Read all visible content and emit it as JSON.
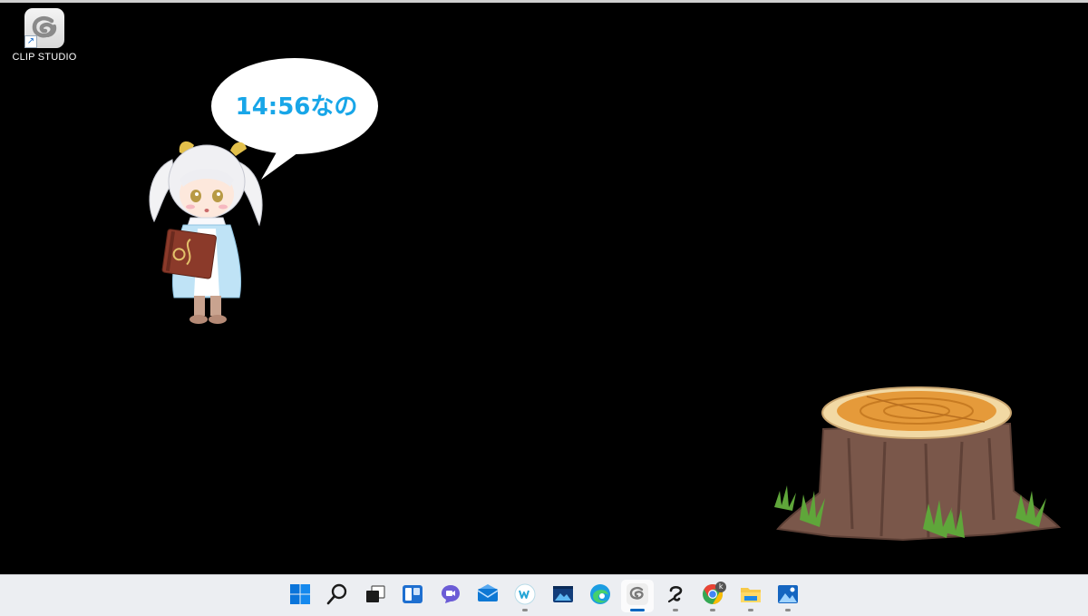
{
  "desktop": {
    "shortcut_label": "CLIP STUDIO",
    "speech_bubble_text": "14:56なの"
  },
  "taskbar": {
    "items": [
      {
        "icon": "windows-start-icon",
        "running": false
      },
      {
        "icon": "search-icon",
        "running": false
      },
      {
        "icon": "task-view-icon",
        "running": false
      },
      {
        "icon": "widgets-icon",
        "running": false
      },
      {
        "icon": "teams-chat-icon",
        "running": false
      },
      {
        "icon": "mail-icon",
        "running": false
      },
      {
        "icon": "w-app-icon",
        "running": true
      },
      {
        "icon": "video-editor-icon",
        "running": false
      },
      {
        "icon": "edge-icon",
        "running": false
      },
      {
        "icon": "clip-studio-icon",
        "running": true,
        "active": true
      },
      {
        "icon": "clip-studio-paint-icon",
        "running": true
      },
      {
        "icon": "chrome-icon",
        "running": true,
        "badge": "k"
      },
      {
        "icon": "file-explorer-icon",
        "running": true
      },
      {
        "icon": "photos-icon",
        "running": true
      }
    ]
  },
  "colors": {
    "desktop_background": "#000000",
    "taskbar_background": "#eceef2",
    "bubble_text": "#18a6e8",
    "accent": "#0067c0"
  }
}
